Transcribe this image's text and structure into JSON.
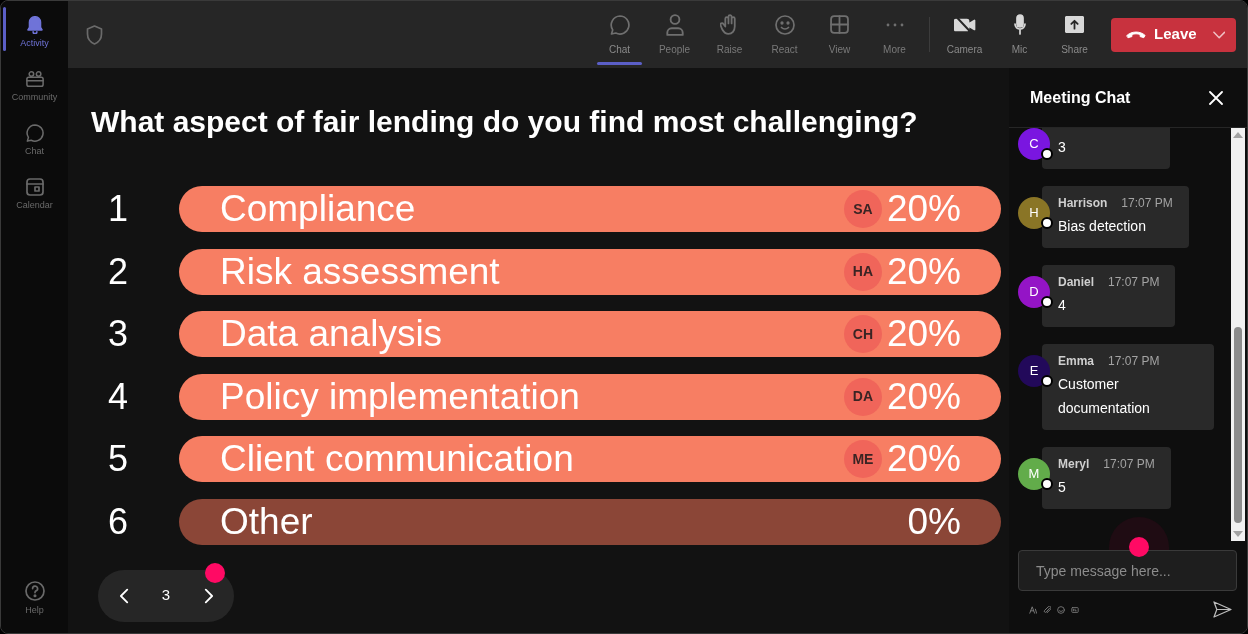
{
  "sidebar": {
    "items": [
      {
        "label": "Activity",
        "selected": true
      },
      {
        "label": "Community",
        "selected": false
      },
      {
        "label": "Chat",
        "selected": false
      },
      {
        "label": "Calendar",
        "selected": false
      }
    ],
    "footer": {
      "label": "Help"
    }
  },
  "toolbar": {
    "actions": [
      {
        "label": "Chat",
        "selected": true
      },
      {
        "label": "People",
        "selected": false
      },
      {
        "label": "Raise",
        "selected": false
      },
      {
        "label": "React",
        "selected": false
      },
      {
        "label": "View",
        "selected": false
      },
      {
        "label": "More",
        "selected": false
      }
    ],
    "devices": [
      {
        "label": "Camera"
      },
      {
        "label": "Mic"
      },
      {
        "label": "Share"
      }
    ],
    "leave_button": {
      "label": "Leave"
    }
  },
  "poll": {
    "question": "What aspect of fair lending do you find most challenging?",
    "options": [
      {
        "number": "1",
        "label": "Compliance",
        "voter": "SA",
        "percent": "20%",
        "dimmed": false
      },
      {
        "number": "2",
        "label": "Risk assessment",
        "voter": "HA",
        "percent": "20%",
        "dimmed": false
      },
      {
        "number": "3",
        "label": "Data analysis",
        "voter": "CH",
        "percent": "20%",
        "dimmed": false
      },
      {
        "number": "4",
        "label": "Policy implementation",
        "voter": "DA",
        "percent": "20%",
        "dimmed": false
      },
      {
        "number": "5",
        "label": "Client communication",
        "voter": "ME",
        "percent": "20%",
        "dimmed": false
      },
      {
        "number": "6",
        "label": "Other",
        "percent": "0%",
        "dimmed": true
      }
    ]
  },
  "pager": {
    "page": "3"
  },
  "chat": {
    "title": "Meeting Chat",
    "messages": [
      {
        "initial": "C",
        "color": "#7a16e0",
        "text": "3"
      },
      {
        "initial": "H",
        "color": "#8a7526",
        "name": "Harrison",
        "time": "17:07 PM",
        "text": "Bias detection"
      },
      {
        "initial": "D",
        "color": "#9414c6",
        "name": "Daniel",
        "time": "17:07 PM",
        "text": "4"
      },
      {
        "initial": "E",
        "color": "#22095a",
        "name": "Emma",
        "time": "17:07 PM",
        "text": "Customer documentation"
      },
      {
        "initial": "M",
        "color": "#62ac4a",
        "name": "Meryl",
        "time": "17:07 PM",
        "text": "5"
      }
    ],
    "input": {
      "placeholder": "Type message here..."
    }
  }
}
